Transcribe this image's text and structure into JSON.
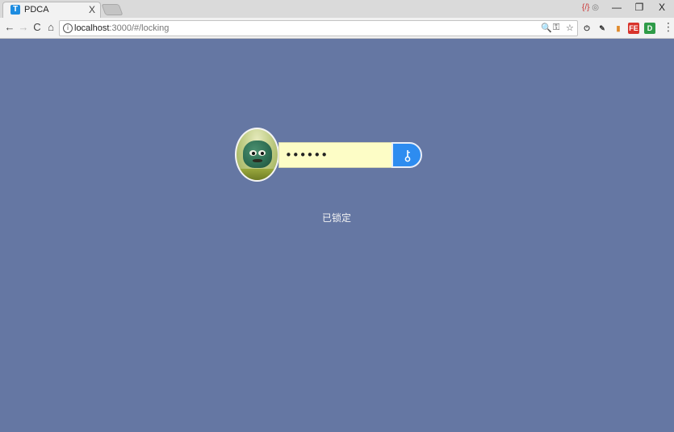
{
  "browser": {
    "tab": {
      "favicon_letter": "T",
      "title": "PDCA",
      "close": "X"
    },
    "address": {
      "host": "localhost",
      "path": ":3000/#/locking"
    },
    "buttons": {
      "back": "←",
      "forward": "→",
      "reload": "C",
      "home": "⌂"
    },
    "omnibox_icons": {
      "zoom": "🔍",
      "key": "⚿",
      "star": "☆"
    },
    "extensions": [
      {
        "name": "power",
        "label": "⏻"
      },
      {
        "name": "pen",
        "label": "✎"
      },
      {
        "name": "bookmark",
        "label": "▮"
      },
      {
        "name": "fe",
        "label": "FE"
      },
      {
        "name": "d",
        "label": "D"
      }
    ],
    "window_controls": {
      "minimize": "—",
      "restore": "❐",
      "close": "X"
    },
    "window_ext_icons": {
      "a": "{/}",
      "b": "◎"
    },
    "menu": "⋮"
  },
  "lock_screen": {
    "password_mask": "••••••",
    "status_text": "已锁定"
  },
  "colors": {
    "background": "#6577a3",
    "accent": "#2d8cf0",
    "input_bg": "#fdfdc6"
  }
}
